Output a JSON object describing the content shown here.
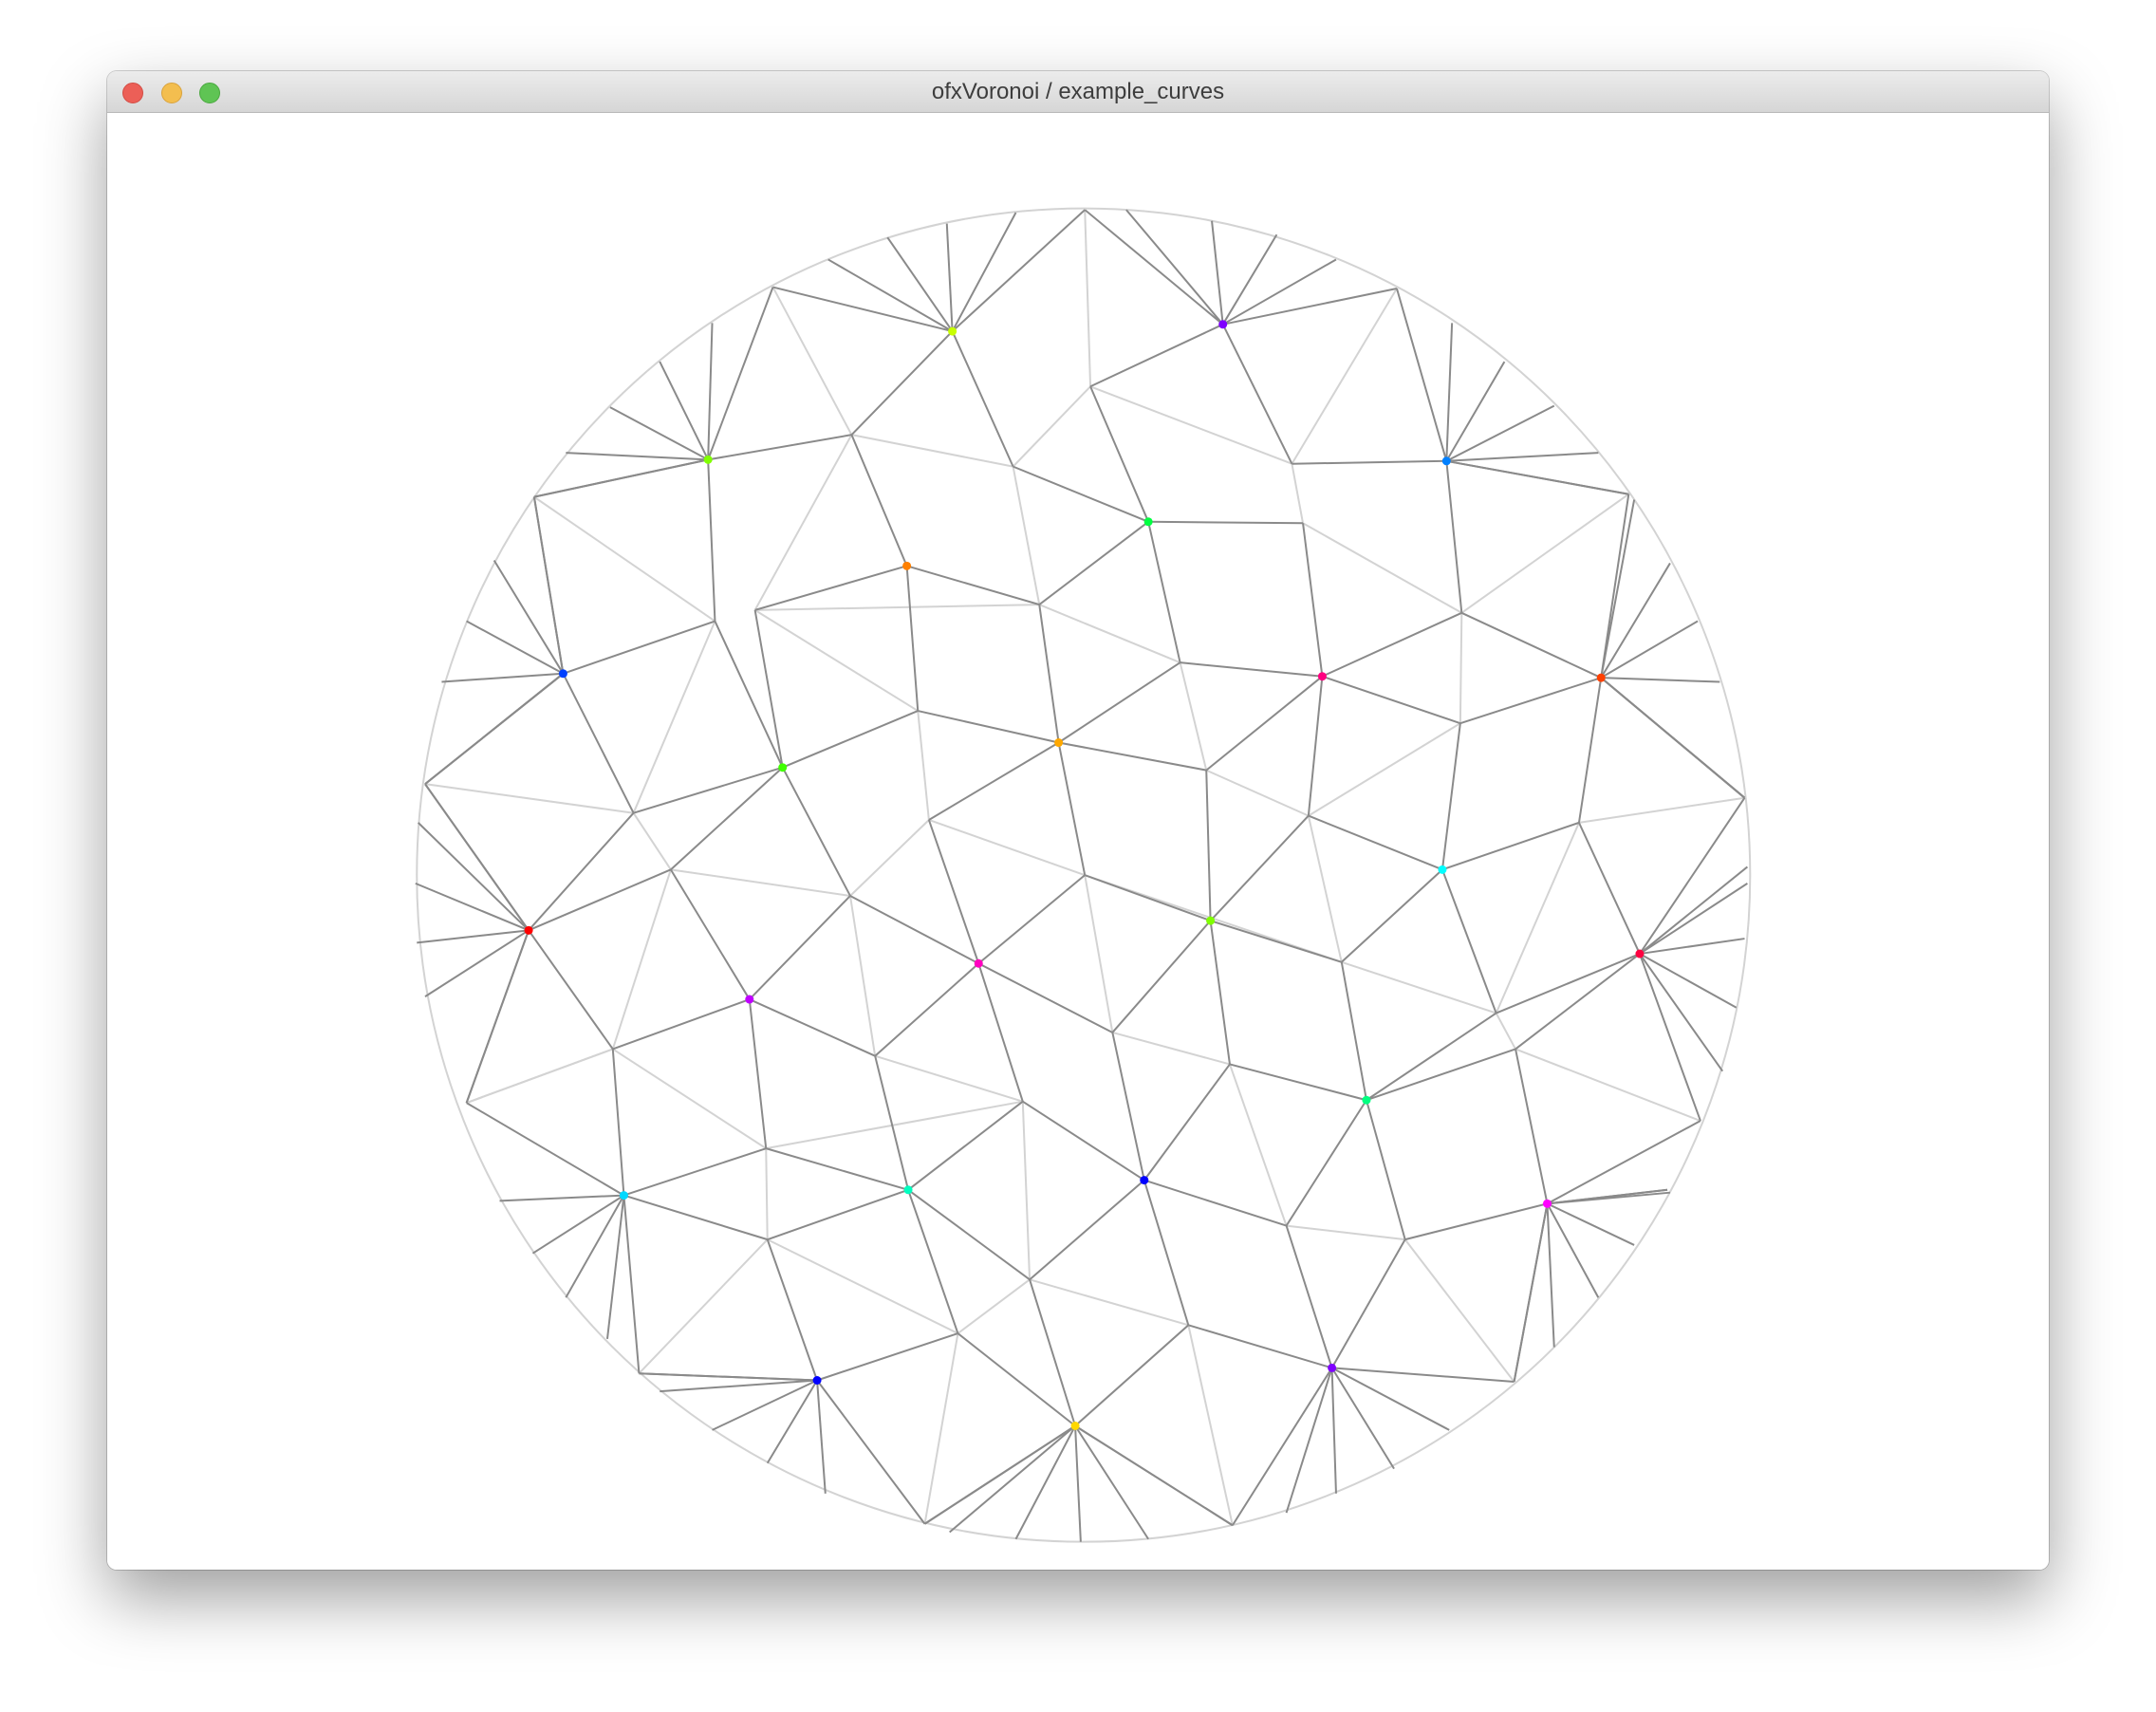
{
  "window": {
    "title": "ofxVoronoi / example_curves",
    "buttons": {
      "close": "close-button",
      "minimize": "minimize-button",
      "zoom": "zoom-button"
    }
  },
  "canvas": {
    "background": "#ffffff",
    "bright_edge_color": "#d3d3d3",
    "dark_edge_color": "#8a8a8a",
    "circle_border_color": "#d3d3d3",
    "site_colors": [
      "#c8ff00",
      "#7f00ff",
      "#80ff00",
      "#0080ff",
      "#00ff40",
      "#ff8000",
      "#0040ff",
      "#ff0080",
      "#ff4000",
      "#40ff00",
      "#ffa800",
      "#00ffff",
      "#ff0000",
      "#80ff00",
      "#ff00c0",
      "#c000ff",
      "#00ff80",
      "#00ffc0",
      "#0000ff",
      "#ff00ff",
      "#0000ff",
      "#7f00ff",
      "#ffd800"
    ]
  }
}
